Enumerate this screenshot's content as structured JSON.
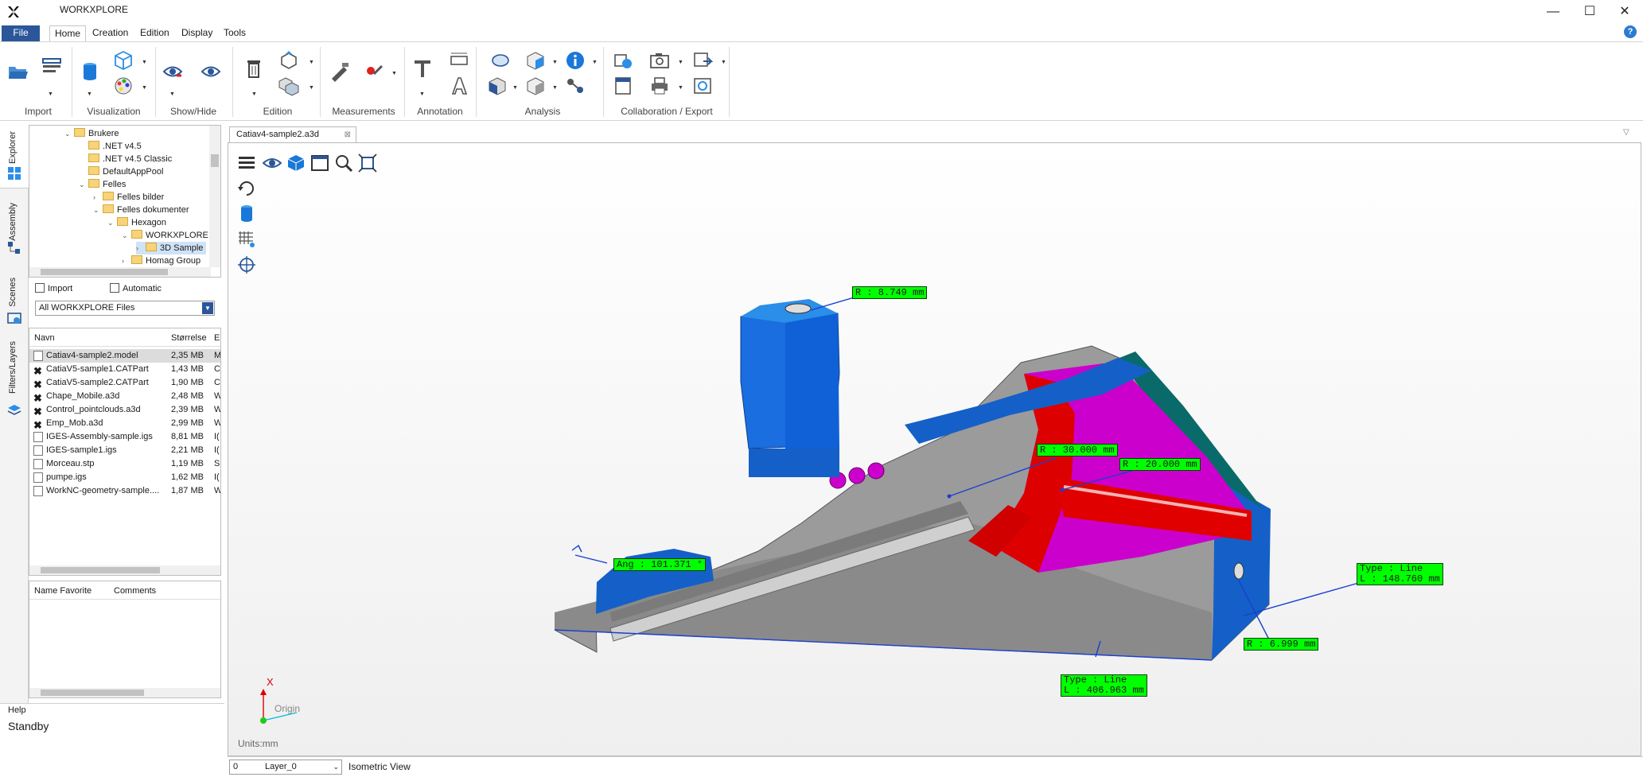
{
  "window": {
    "title": "WORKXPLORE",
    "minimize": "—",
    "maximize": "☐",
    "close": "✕"
  },
  "menu": {
    "file": "File",
    "tabs": [
      "Home",
      "Creation",
      "Edition",
      "Display",
      "Tools"
    ],
    "help_icon": "?"
  },
  "ribbon": {
    "groups": [
      "Import",
      "Visualization",
      "Show/Hide",
      "Edition",
      "Measurements",
      "Annotation",
      "Analysis",
      "Collaboration / Export"
    ]
  },
  "side_tabs": [
    "Explorer",
    "Assembly",
    "Scenes",
    "Filters/Layers"
  ],
  "tree": {
    "items": [
      "Brukere",
      ".NET v4.5",
      ".NET v4.5 Classic",
      "DefaultAppPool",
      "Felles",
      "Felles bilder",
      "Felles dokumenter",
      "Hexagon",
      "WORKXPLORE",
      "3D Sample",
      "Homag Group"
    ]
  },
  "filters": {
    "import_label": "Import",
    "automatic_label": "Automatic",
    "file_type": "All WORKXPLORE Files"
  },
  "file_list": {
    "headers": [
      "Navn",
      "Størrelse",
      "El"
    ],
    "rows": [
      {
        "name": "Catiav4-sample2.model",
        "size": "2,35 MB",
        "ext": "M"
      },
      {
        "name": "CatiaV5-sample1.CATPart",
        "size": "1,43 MB",
        "ext": "C"
      },
      {
        "name": "CatiaV5-sample2.CATPart",
        "size": "1,90 MB",
        "ext": "C"
      },
      {
        "name": "Chape_Mobile.a3d",
        "size": "2,48 MB",
        "ext": "W"
      },
      {
        "name": "Control_pointclouds.a3d",
        "size": "2,39 MB",
        "ext": "W"
      },
      {
        "name": "Emp_Mob.a3d",
        "size": "2,99 MB",
        "ext": "W"
      },
      {
        "name": "IGES-Assembly-sample.igs",
        "size": "8,81 MB",
        "ext": "I("
      },
      {
        "name": "IGES-sample1.igs",
        "size": "2,21 MB",
        "ext": "I("
      },
      {
        "name": "Morceau.stp",
        "size": "1,19 MB",
        "ext": "SI"
      },
      {
        "name": "pumpe.igs",
        "size": "1,62 MB",
        "ext": "I("
      },
      {
        "name": "WorkNC-geometry-sample....",
        "size": "1,87 MB",
        "ext": "W"
      }
    ]
  },
  "favorites": {
    "headers": [
      "Name Favorite",
      "Comments"
    ]
  },
  "help": {
    "title": "Help",
    "status": "Standby"
  },
  "document": {
    "tab": "Catiav4-sample2.a3d",
    "units": "Units:mm",
    "axis_x": "X",
    "origin": "Origin"
  },
  "dimensions": {
    "r1": "R : 8.749 mm",
    "r2": "R : 30.000 mm",
    "r3": "R : 20.000 mm",
    "ang": "Ang : 101.371 °",
    "line1_type": "Type : Line",
    "line1_len": "L : 148.760 mm",
    "r4": "R : 6.999 mm",
    "line2_type": "Type : Line",
    "line2_len": "L : 406.963 mm"
  },
  "statusbar": {
    "layer_num": "0",
    "layer_name": "Layer_0",
    "view": "Isometric View"
  },
  "colors": {
    "accent": "#2b579a",
    "dim_fill": "#00ff00",
    "blue_part": "#1060d8",
    "magenta": "#d000d0",
    "red": "#e00000",
    "grey": "#9a9a9a",
    "teal": "#0a6a6a"
  }
}
